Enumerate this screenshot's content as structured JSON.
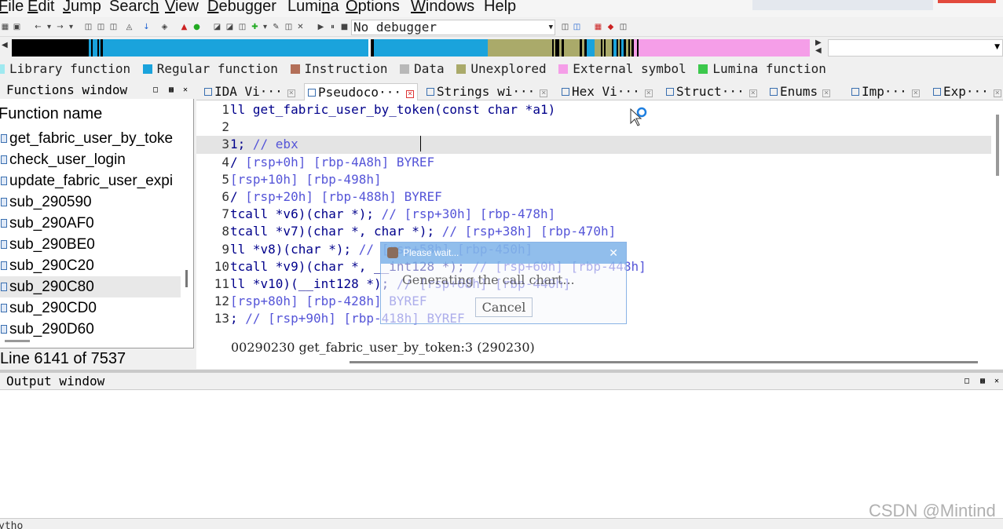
{
  "menu": [
    "File",
    "Edit",
    "Jump",
    "Search",
    "View",
    "Debugger",
    "Lumina",
    "Options",
    "Windows",
    "Help"
  ],
  "toolbar": {
    "debugger_value": "No debugger"
  },
  "colors": {
    "library": "#9fe9f0",
    "regular": "#1aa3dc",
    "instruction": "#b36f58",
    "data": "#b8b8b8",
    "unexplored": "#aaaa6a",
    "external": "#f59ee8",
    "lumina": "#3cc84c",
    "navband_bg": "#000000"
  },
  "legend": [
    "Library function",
    "Regular function",
    "Instruction",
    "Data",
    "Unexplored",
    "External symbol",
    "Lumina function"
  ],
  "functions": {
    "title": "Functions window",
    "column": "Function name",
    "items": [
      "get_fabric_user_by_toke",
      "check_user_login",
      "update_fabric_user_expi",
      "sub_290590",
      "sub_290AF0",
      "sub_290BE0",
      "sub_290C20",
      "sub_290C80",
      "sub_290CD0",
      "sub_290D60"
    ],
    "selected": "sub_290C80",
    "status": "Line 6141 of 7537"
  },
  "tabs": [
    "IDA Vi···",
    "Pseudoco···",
    "Strings wi···",
    "Hex Vi···",
    "Struct···",
    "Enums",
    "Imp···",
    "Exp···"
  ],
  "active_tab": "Pseudoco···",
  "code": [
    {
      "n": "1",
      "code": "ll get_fabric_user_by_token(const char *a1)",
      "comment": ""
    },
    {
      "n": "2",
      "code": "",
      "comment": ""
    },
    {
      "n": "3",
      "code": "1;",
      "comment": " // ebx"
    },
    {
      "n": "4",
      "code": "/",
      "comment": " [rsp+0h] [rbp-4A8h] BYREF"
    },
    {
      "n": "5",
      "code": "",
      "comment": " [rsp+10h] [rbp-498h]"
    },
    {
      "n": "6",
      "code": "/",
      "comment": " [rsp+20h] [rbp-488h] BYREF"
    },
    {
      "n": "7",
      "code": "tcall *v6)(char *);",
      "comment": " // [rsp+30h] [rbp-478h]"
    },
    {
      "n": "8",
      "code": "tcall *v7)(char *, char *);",
      "comment": " // [rsp+38h] [rbp-470h]"
    },
    {
      "n": "9",
      "code": "ll *v8)(char *);",
      "comment": " // [rsp+58h] [rbp-450h]"
    },
    {
      "n": "10",
      "code": "tcall *v9)(char *, __int128 *);",
      "comment": " // [rsp+60h] [rbp-448h]"
    },
    {
      "n": "11",
      "code": "ll *v10)(__int128 *);",
      "comment": " // [rsp+68h] [rbp-440h]"
    },
    {
      "n": "12",
      "code": "",
      "comment": " [rsp+80h] [rbp-428h] BYREF"
    },
    {
      "n": "13",
      "code": ";",
      "comment": " // [rsp+90h] [rbp-418h] BYREF"
    }
  ],
  "pseudo_status": "00290230 get_fabric_user_by_token:3 (290230)",
  "dialog": {
    "title": "Please wait...",
    "message": "Generating the call chart...",
    "cancel": "Cancel"
  },
  "output": {
    "title": "Output window",
    "python_label": "ytho"
  },
  "watermark": "CSDN @Mintind"
}
